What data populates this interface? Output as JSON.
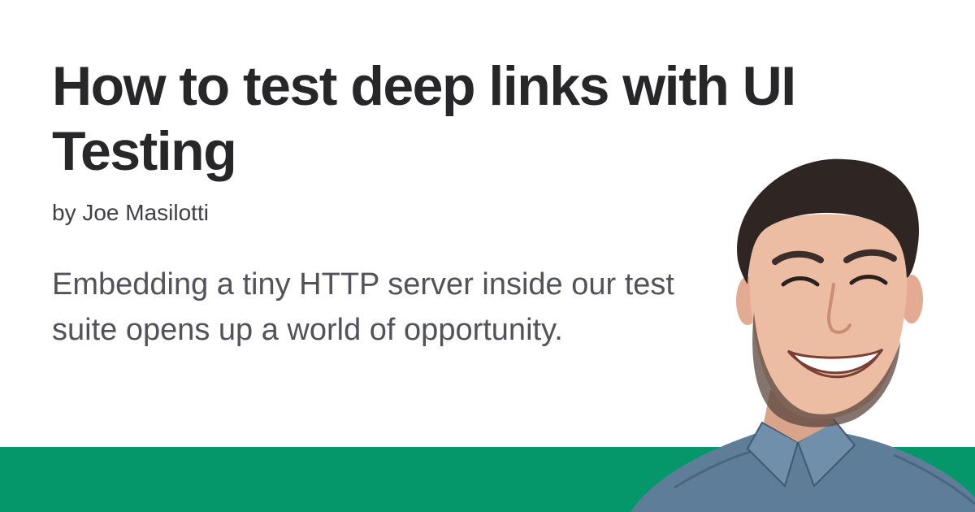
{
  "post": {
    "title": "How to test deep links with UI Testing",
    "byline": "by Joe Masilotti",
    "description": "Embedding a tiny HTTP server inside our test suite opens up a world of opportunity."
  },
  "colors": {
    "background": "#ffffff",
    "title": "#27272a",
    "byline": "#3f3f46",
    "description": "#52525b",
    "accent_band": "#059669"
  },
  "icons": {
    "author_photo": "author-portrait"
  }
}
